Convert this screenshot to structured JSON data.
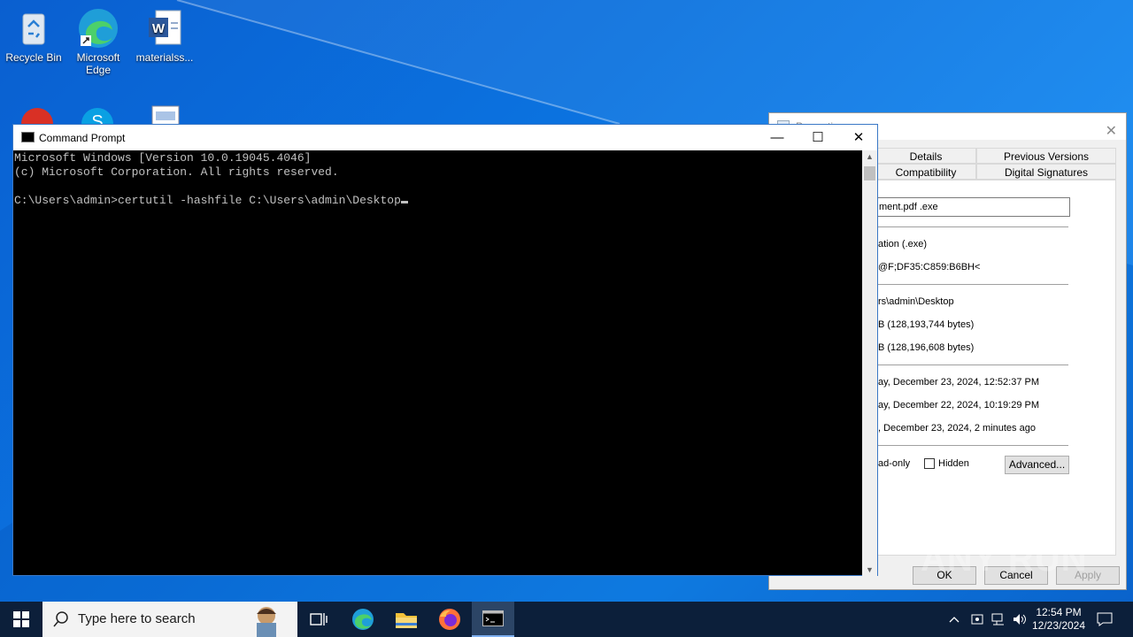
{
  "desktop": {
    "icons": [
      {
        "label": "Recycle Bin",
        "icon": "recycle-bin-icon"
      },
      {
        "label": "Microsoft Edge",
        "icon": "edge-icon"
      },
      {
        "label": "materialss...",
        "icon": "word-document-icon"
      }
    ]
  },
  "properties": {
    "title": "Properties",
    "tabs": [
      "Details",
      "Previous Versions",
      "Compatibility",
      "Digital Signatures"
    ],
    "filename": "ment.pdf .exe",
    "type": "ation (.exe)",
    "opens": "@F;DF35:C859:B6BH<",
    "location": "rs\\admin\\Desktop",
    "size": "B (128,193,744 bytes)",
    "size_on_disk": "B (128,196,608 bytes)",
    "created": "ay, December 23, 2024, 12:52:37 PM",
    "modified": "ay, December 22, 2024, 10:19:29 PM",
    "accessed": ", December 23, 2024, 2 minutes ago",
    "readonly_label": "ad-only",
    "hidden_label": "Hidden",
    "advanced_label": "Advanced...",
    "ok_label": "OK",
    "cancel_label": "Cancel",
    "apply_label": "Apply"
  },
  "cmd": {
    "title": "Command Prompt",
    "line1": "Microsoft Windows [Version 10.0.19045.4046]",
    "line2": "(c) Microsoft Corporation. All rights reserved.",
    "prompt": "C:\\Users\\admin>certutil -hashfile C:\\Users\\admin\\Desktop"
  },
  "taskbar": {
    "search_placeholder": "Type here to search",
    "time": "12:54 PM",
    "date": "12/23/2024"
  },
  "watermark": "ANY RUN"
}
